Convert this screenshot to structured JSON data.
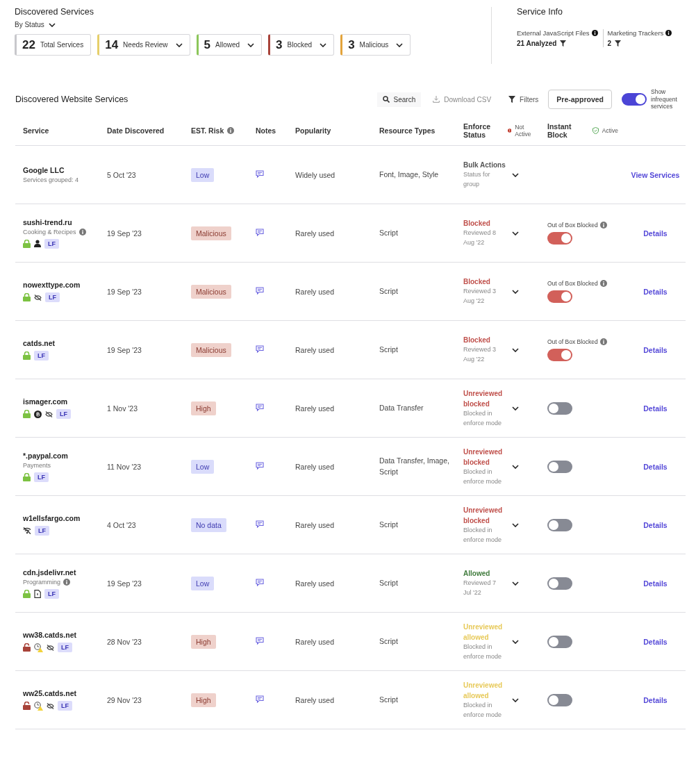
{
  "summary": {
    "title": "Discovered Services",
    "group_by": "By Status",
    "cards": [
      {
        "count": "22",
        "label": "Total Services",
        "color": "#c8c8cc",
        "dropdown": false
      },
      {
        "count": "14",
        "label": "Needs Review",
        "color": "#e6cf6a",
        "dropdown": true
      },
      {
        "count": "5",
        "label": "Allowed",
        "color": "#8cc65a",
        "dropdown": true
      },
      {
        "count": "3",
        "label": "Blocked",
        "color": "#a8433a",
        "dropdown": true
      },
      {
        "count": "3",
        "label": "Malicious",
        "color": "#e3a43c",
        "dropdown": true
      }
    ]
  },
  "service_info": {
    "title": "Service Info",
    "items": [
      {
        "label": "External JavaScript Files",
        "value": "21 Analyzed"
      },
      {
        "label": "Marketing Trackers",
        "value": "2"
      }
    ]
  },
  "table": {
    "title": "Discovered Website Services",
    "toolbar": {
      "search": "Search",
      "download": "Download CSV",
      "filters": "Filters",
      "preapproved": "Pre-approved",
      "infrequent_toggle": {
        "on": true,
        "label": "Show infrequent services"
      }
    },
    "columns": [
      {
        "label": "Service"
      },
      {
        "label": "Date Discovered"
      },
      {
        "label": "EST. Risk",
        "info": true
      },
      {
        "label": "Notes"
      },
      {
        "label": "Popularity"
      },
      {
        "label": "Resource Types"
      },
      {
        "label": "Enforce Status",
        "legend": {
          "kind": "not-active",
          "text": "Not Active"
        }
      },
      {
        "label": "Instant Block",
        "legend": {
          "kind": "active",
          "text": "Active"
        }
      }
    ],
    "rows": [
      {
        "name": "Google LLC",
        "subtitle": "Services grouped: 4",
        "icons": [],
        "date": "5 Oct '23",
        "risk": {
          "label": "Low",
          "kind": "low"
        },
        "popularity": "Widely used",
        "resource_types": "Font, Image, Style",
        "enforce": {
          "status": "Bulk Actions",
          "kind": "bulk",
          "note": "Status for group"
        },
        "action": "View Services"
      },
      {
        "name": "sushi-trend.ru",
        "subtitle": "Cooking & Recipes",
        "subtitle_info": true,
        "icons": [
          {
            "kind": "lock"
          },
          {
            "kind": "person"
          }
        ],
        "badge": "LF",
        "date": "19 Sep '23",
        "risk": {
          "label": "Malicious",
          "kind": "malicious"
        },
        "popularity": "Rarely used",
        "resource_types": "Script",
        "enforce": {
          "status": "Blocked",
          "kind": "blocked",
          "note": "Reviewed 8 Aug '22"
        },
        "instant_block": {
          "label": "Out of Box Blocked",
          "on": true
        },
        "action": "Details"
      },
      {
        "name": "nowexttype.com",
        "icons": [
          {
            "kind": "lock"
          },
          {
            "kind": "eye-slash"
          }
        ],
        "badge": "LF",
        "date": "19 Sep '23",
        "risk": {
          "label": "Malicious",
          "kind": "malicious"
        },
        "popularity": "Rarely used",
        "resource_types": "Script",
        "enforce": {
          "status": "Blocked",
          "kind": "blocked",
          "note": "Reviewed 3 Aug '22"
        },
        "instant_block": {
          "label": "Out of Box Blocked",
          "on": true
        },
        "action": "Details"
      },
      {
        "name": "catds.net",
        "icons": [
          {
            "kind": "lock"
          }
        ],
        "badge": "LF",
        "date": "19 Sep '23",
        "risk": {
          "label": "Malicious",
          "kind": "malicious"
        },
        "popularity": "Rarely used",
        "resource_types": "Script",
        "enforce": {
          "status": "Blocked",
          "kind": "blocked",
          "note": "Reviewed 3 Aug '22"
        },
        "instant_block": {
          "label": "Out of Box Blocked",
          "on": true
        },
        "action": "Details"
      },
      {
        "name": "ismager.com",
        "icons": [
          {
            "kind": "lock"
          },
          {
            "kind": "coin"
          },
          {
            "kind": "eye-slash"
          }
        ],
        "badge": "LF",
        "date": "1 Nov '23",
        "risk": {
          "label": "High",
          "kind": "high"
        },
        "popularity": "Rarely used",
        "resource_types": "Data Transfer",
        "enforce": {
          "status": "Unreviewed blocked",
          "kind": "blocked",
          "note": "Blocked in enforce mode"
        },
        "instant_block": {
          "on": false
        },
        "action": "Details"
      },
      {
        "name": "*.paypal.com",
        "subtitle": "Payments",
        "icons": [
          {
            "kind": "lock"
          }
        ],
        "badge": "LF",
        "date": "11 Nov '23",
        "risk": {
          "label": "Low",
          "kind": "low"
        },
        "popularity": "Rarely used",
        "resource_types": "Data Transfer, Image, Script",
        "enforce": {
          "status": "Unreviewed blocked",
          "kind": "blocked",
          "note": "Blocked in enforce mode"
        },
        "instant_block": {
          "on": false
        },
        "action": "Details"
      },
      {
        "name": "w1ellsfargo.com",
        "icons": [
          {
            "kind": "wifi-off"
          }
        ],
        "badge": "LF",
        "date": "4 Oct '23",
        "risk": {
          "label": "No data",
          "kind": "nodata"
        },
        "popularity": "Rarely used",
        "resource_types": "Script",
        "enforce": {
          "status": "Unreviewed blocked",
          "kind": "blocked",
          "note": "Blocked in enforce mode"
        },
        "instant_block": {
          "on": false
        },
        "action": "Details"
      },
      {
        "name": "cdn.jsdelivr.net",
        "subtitle": "Programming",
        "subtitle_info": true,
        "icons": [
          {
            "kind": "lock"
          },
          {
            "kind": "document"
          }
        ],
        "badge": "LF",
        "date": "19 Sep '23",
        "risk": {
          "label": "Low",
          "kind": "low"
        },
        "popularity": "Rarely used",
        "resource_types": "Script",
        "enforce": {
          "status": "Allowed",
          "kind": "allowed",
          "note": "Reviewed 7 Jul '22"
        },
        "instant_block": {
          "on": false
        },
        "action": "Details"
      },
      {
        "name": "ww38.catds.net",
        "icons": [
          {
            "kind": "unlock"
          },
          {
            "kind": "clock-warning"
          },
          {
            "kind": "eye-slash"
          }
        ],
        "badge": "LF",
        "date": "28 Nov '23",
        "risk": {
          "label": "High",
          "kind": "high"
        },
        "popularity": "Rarely used",
        "resource_types": "Script",
        "enforce": {
          "status": "Unreviewed allowed",
          "kind": "pending",
          "note": "Blocked in enforce mode"
        },
        "instant_block": {
          "on": false
        },
        "action": "Details"
      },
      {
        "name": "ww25.catds.net",
        "icons": [
          {
            "kind": "unlock"
          },
          {
            "kind": "clock-warning"
          },
          {
            "kind": "eye-slash"
          }
        ],
        "badge": "LF",
        "date": "29 Nov '23",
        "risk": {
          "label": "High",
          "kind": "high"
        },
        "popularity": "Rarely used",
        "resource_types": "Script",
        "enforce": {
          "status": "Unreviewed allowed",
          "kind": "pending",
          "note": "Blocked in enforce mode"
        },
        "instant_block": {
          "on": false
        },
        "action": "Details"
      }
    ]
  }
}
